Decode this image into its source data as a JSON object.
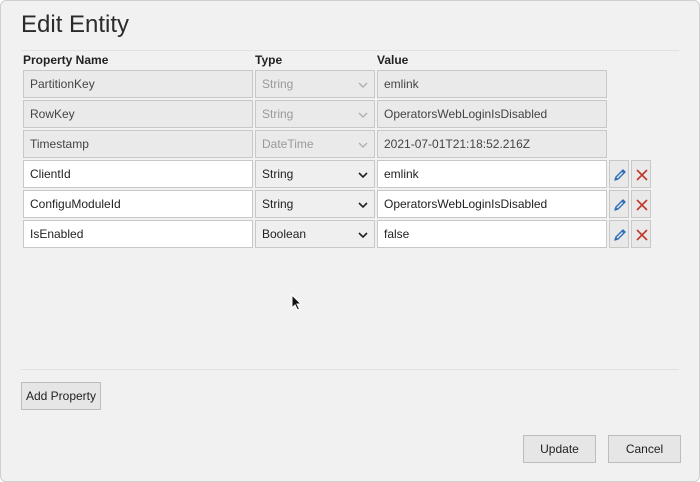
{
  "dialog": {
    "title": "Edit Entity"
  },
  "columns": {
    "name": "Property Name",
    "type": "Type",
    "value": "Value"
  },
  "rows": [
    {
      "name": "PartitionKey",
      "type": "String",
      "value": "emlink",
      "editable": false
    },
    {
      "name": "RowKey",
      "type": "String",
      "value": "OperatorsWebLoginIsDisabled",
      "editable": false
    },
    {
      "name": "Timestamp",
      "type": "DateTime",
      "value": "2021-07-01T21:18:52.216Z",
      "editable": false
    },
    {
      "name": "ClientId",
      "type": "String",
      "value": "emlink",
      "editable": true
    },
    {
      "name": "ConfiguModuleId",
      "type": "String",
      "value": "OperatorsWebLoginIsDisabled",
      "editable": true
    },
    {
      "name": "IsEnabled",
      "type": "Boolean",
      "value": "false",
      "editable": true
    }
  ],
  "buttons": {
    "add": "Add Property",
    "update": "Update",
    "cancel": "Cancel"
  },
  "icons": {
    "edit": "pencil-icon",
    "delete": "close-icon",
    "dropdown": "chevron-down-icon"
  },
  "colors": {
    "edit_icon": "#2f6fb5",
    "delete_icon": "#c0392b"
  }
}
